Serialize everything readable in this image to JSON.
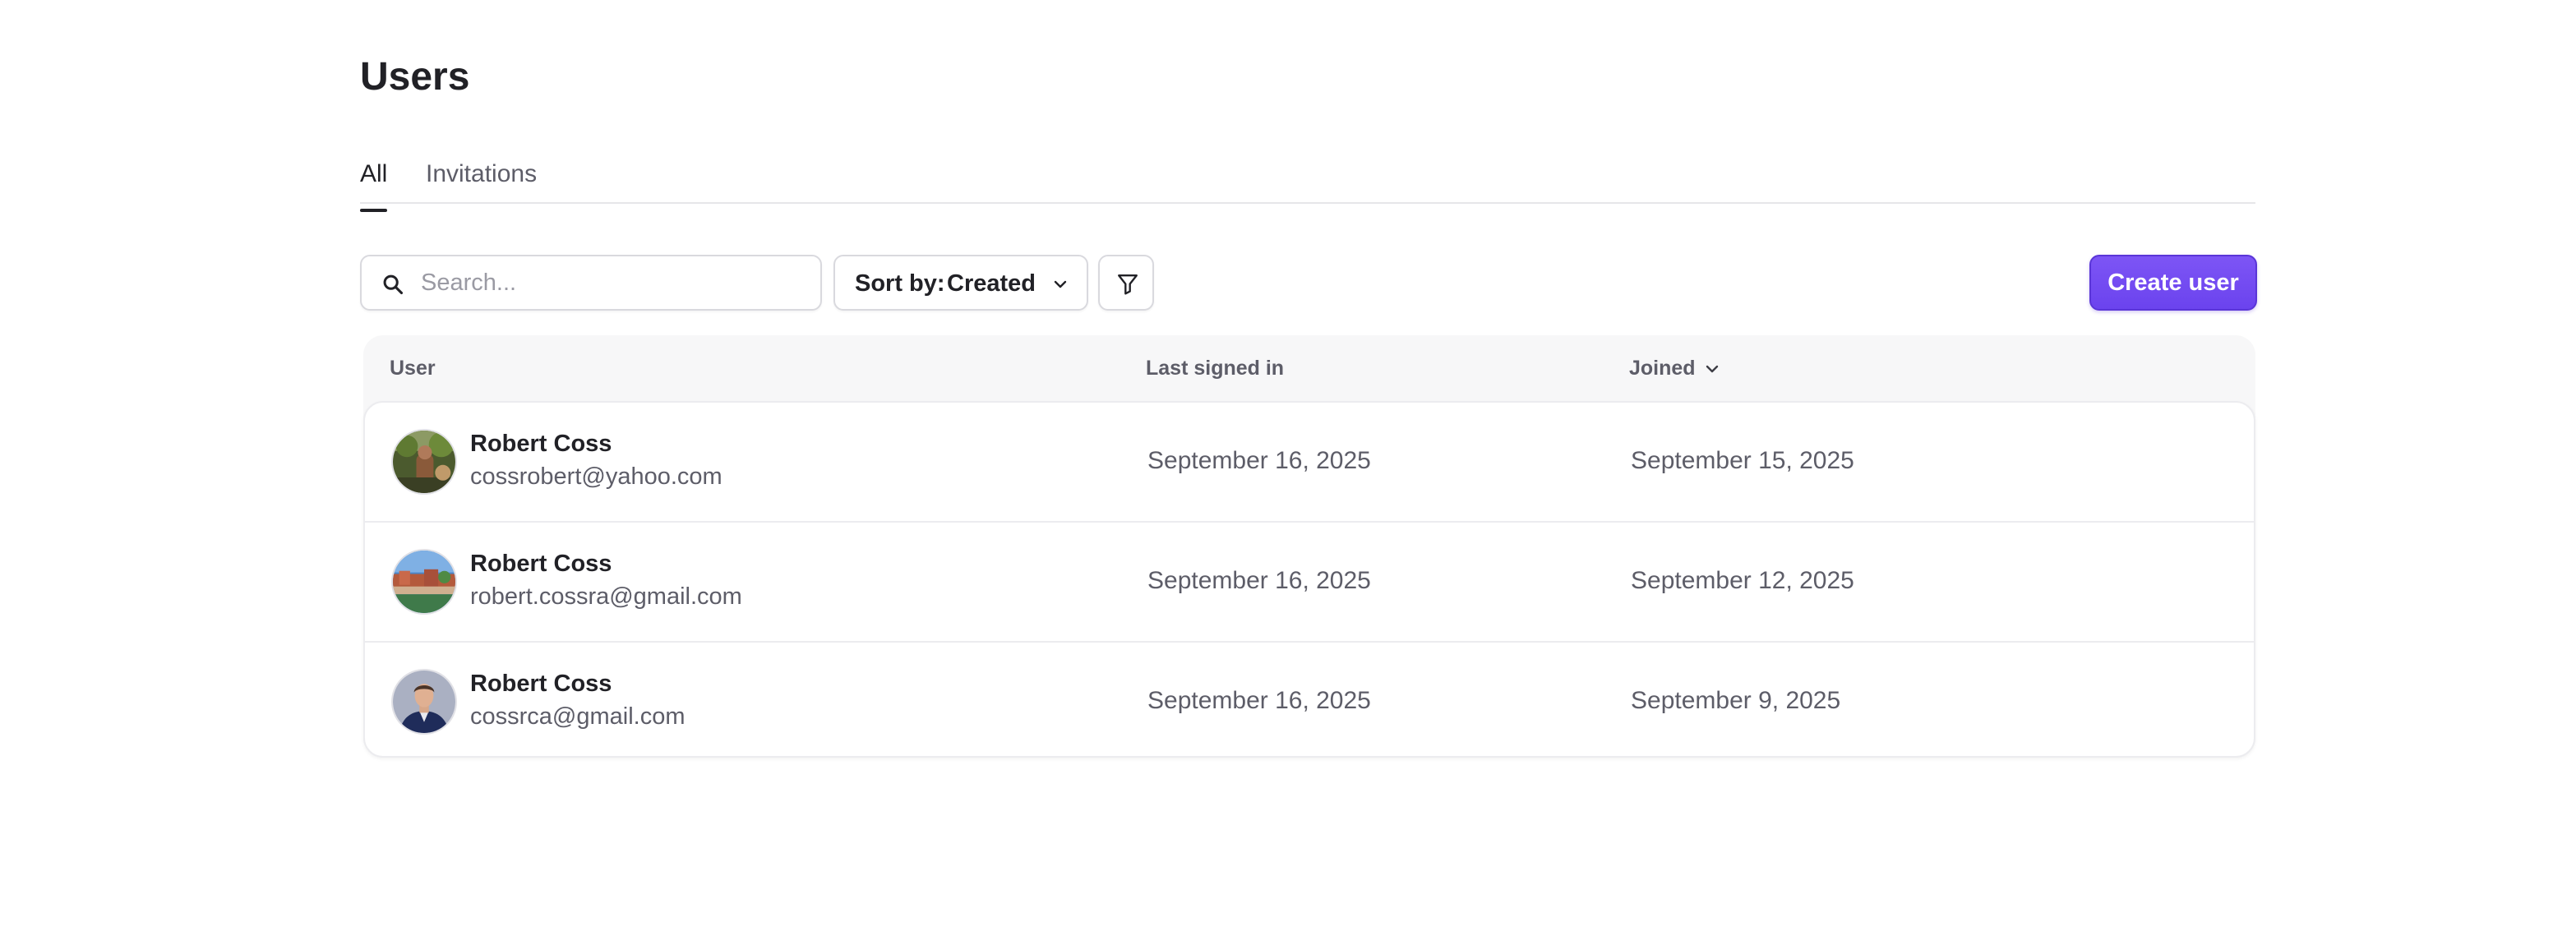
{
  "page": {
    "title": "Users"
  },
  "tabs": [
    {
      "label": "All",
      "active": true
    },
    {
      "label": "Invitations",
      "active": false
    }
  ],
  "toolbar": {
    "search_placeholder": "Search...",
    "search_value": "",
    "sort_label": "Sort by:",
    "sort_value": "Created",
    "create_label": "Create user",
    "accent_color": "#6c47f0"
  },
  "table": {
    "columns": [
      "User",
      "Last signed in",
      "Joined"
    ],
    "rows": [
      {
        "name": "Robert Coss",
        "email": "cossrobert@yahoo.com",
        "last_signed_in": "September 16, 2025",
        "joined": "September 15, 2025"
      },
      {
        "name": "Robert Coss",
        "email": "robert.cossra@gmail.com",
        "last_signed_in": "September 16, 2025",
        "joined": "September 12, 2025"
      },
      {
        "name": "Robert Coss",
        "email": "cossrca@gmail.com",
        "last_signed_in": "September 16, 2025",
        "joined": "September 9, 2025"
      }
    ]
  },
  "icons": {
    "search": "search-icon",
    "sort": "chevron-down-icon",
    "filter": "filter-icon",
    "sort_column": "chevron-down-icon"
  }
}
